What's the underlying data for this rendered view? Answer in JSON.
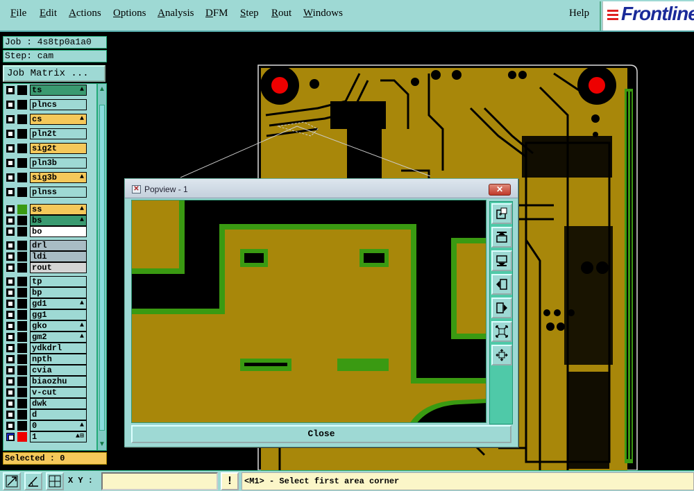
{
  "menu": {
    "items": [
      "File",
      "Edit",
      "Actions",
      "Options",
      "Analysis",
      "DFM",
      "Step",
      "Rout",
      "Windows"
    ],
    "help": "Help"
  },
  "brand": {
    "logo_text": "Frontline"
  },
  "job_panel": {
    "job": "Job : 4s8tp0a1a0",
    "step": "Step: cam",
    "job_matrix_label": "Job Matrix ..."
  },
  "layers": [
    {
      "name": "ts",
      "color": "#3a9a70",
      "mark": "ink-icon"
    },
    {
      "name": "plncs",
      "color": "#9ed9d4",
      "mark": ""
    },
    {
      "name": "cs",
      "color": "#f5c85a",
      "mark": "ink-icon"
    },
    {
      "name": "pln2t",
      "color": "#9ed9d4",
      "mark": ""
    },
    {
      "name": "sig2t",
      "color": "#f5c85a",
      "mark": ""
    },
    {
      "name": "pln3b",
      "color": "#9ed9d4",
      "mark": ""
    },
    {
      "name": "sig3b",
      "color": "#f5c85a",
      "mark": "ink-icon"
    },
    {
      "name": "plnss",
      "color": "#9ed9d4",
      "mark": ""
    },
    {
      "name": "ss",
      "color": "#f5c85a",
      "mark": "ink-icon"
    },
    {
      "name": "bs",
      "color": "#3a9a70",
      "mark": "ink-icon"
    },
    {
      "name": "bo",
      "color": "#ffffff",
      "mark": ""
    },
    {
      "name": "drl",
      "color": "#a8bcc4",
      "mark": ""
    },
    {
      "name": "ldi",
      "color": "#a8bcc4",
      "mark": ""
    },
    {
      "name": "rout",
      "color": "#d4d4d4",
      "mark": ""
    },
    {
      "name": "tp",
      "color": "#9ed9d4",
      "mark": ""
    },
    {
      "name": "bp",
      "color": "#9ed9d4",
      "mark": ""
    },
    {
      "name": "gd1",
      "color": "#9ed9d4",
      "mark": "ink-icon"
    },
    {
      "name": "gg1",
      "color": "#9ed9d4",
      "mark": ""
    },
    {
      "name": "gko",
      "color": "#9ed9d4",
      "mark": "ink-icon"
    },
    {
      "name": "gm2",
      "color": "#9ed9d4",
      "mark": "ink-icon"
    },
    {
      "name": "ydkdrl",
      "color": "#9ed9d4",
      "mark": ""
    },
    {
      "name": "npth",
      "color": "#9ed9d4",
      "mark": ""
    },
    {
      "name": "cvia",
      "color": "#9ed9d4",
      "mark": ""
    },
    {
      "name": "biaozhu",
      "color": "#9ed9d4",
      "mark": ""
    },
    {
      "name": "v-cut",
      "color": "#9ed9d4",
      "mark": ""
    },
    {
      "name": "dwk",
      "color": "#9ed9d4",
      "mark": ""
    },
    {
      "name": "d",
      "color": "#9ed9d4",
      "mark": ""
    },
    {
      "name": "0",
      "color": "#9ed9d4",
      "mark": "ink-icon"
    },
    {
      "name": "1",
      "color": "#9ed9d4",
      "mark": "ink-grid-icon"
    }
  ],
  "selected": "Selected : 0",
  "status": {
    "xy_label": "X Y :",
    "xy_value": "",
    "warn": "!",
    "prompt": "<M1> - Select first area corner"
  },
  "popview": {
    "title": "Popview - 1",
    "close_label": "Close",
    "tools": [
      "zoom-home-icon",
      "pan-up-icon",
      "pan-down-icon",
      "pan-left-icon",
      "pan-right-icon",
      "zoom-out-icon",
      "zoom-in-icon"
    ]
  },
  "colors": {
    "copper": "#a8870a",
    "mask": "#3a9a12",
    "panel": "#9ed9d4",
    "pad_red": "#ee0000"
  }
}
